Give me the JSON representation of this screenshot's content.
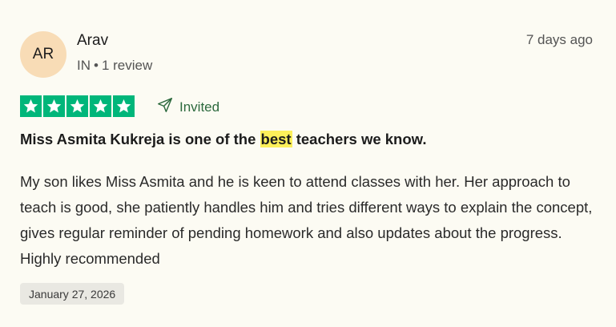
{
  "review": {
    "avatar_initials": "AR",
    "avatar_color": "#f8dcb6",
    "reviewer_name": "Arav",
    "country": "IN",
    "separator": "•",
    "review_count": "1 review",
    "posted_ago": "7 days ago",
    "rating": 5,
    "rating_max": 5,
    "star_color": "#00b67a",
    "invited_icon": "send-icon",
    "invited_label": "Invited",
    "title_before": "Miss Asmita Kukreja is one of the ",
    "title_highlight": "best",
    "title_after": " teachers we know.",
    "highlight_color": "#fdf05a",
    "body": "My son likes Miss Asmita and he is keen to attend classes with her. Her approach to teach is good, she patiently handles him and tries different ways to explain the concept, gives regular reminder of pending homework and also updates about the progress. Highly recommended",
    "date_of_experience": "January 27, 2026"
  }
}
